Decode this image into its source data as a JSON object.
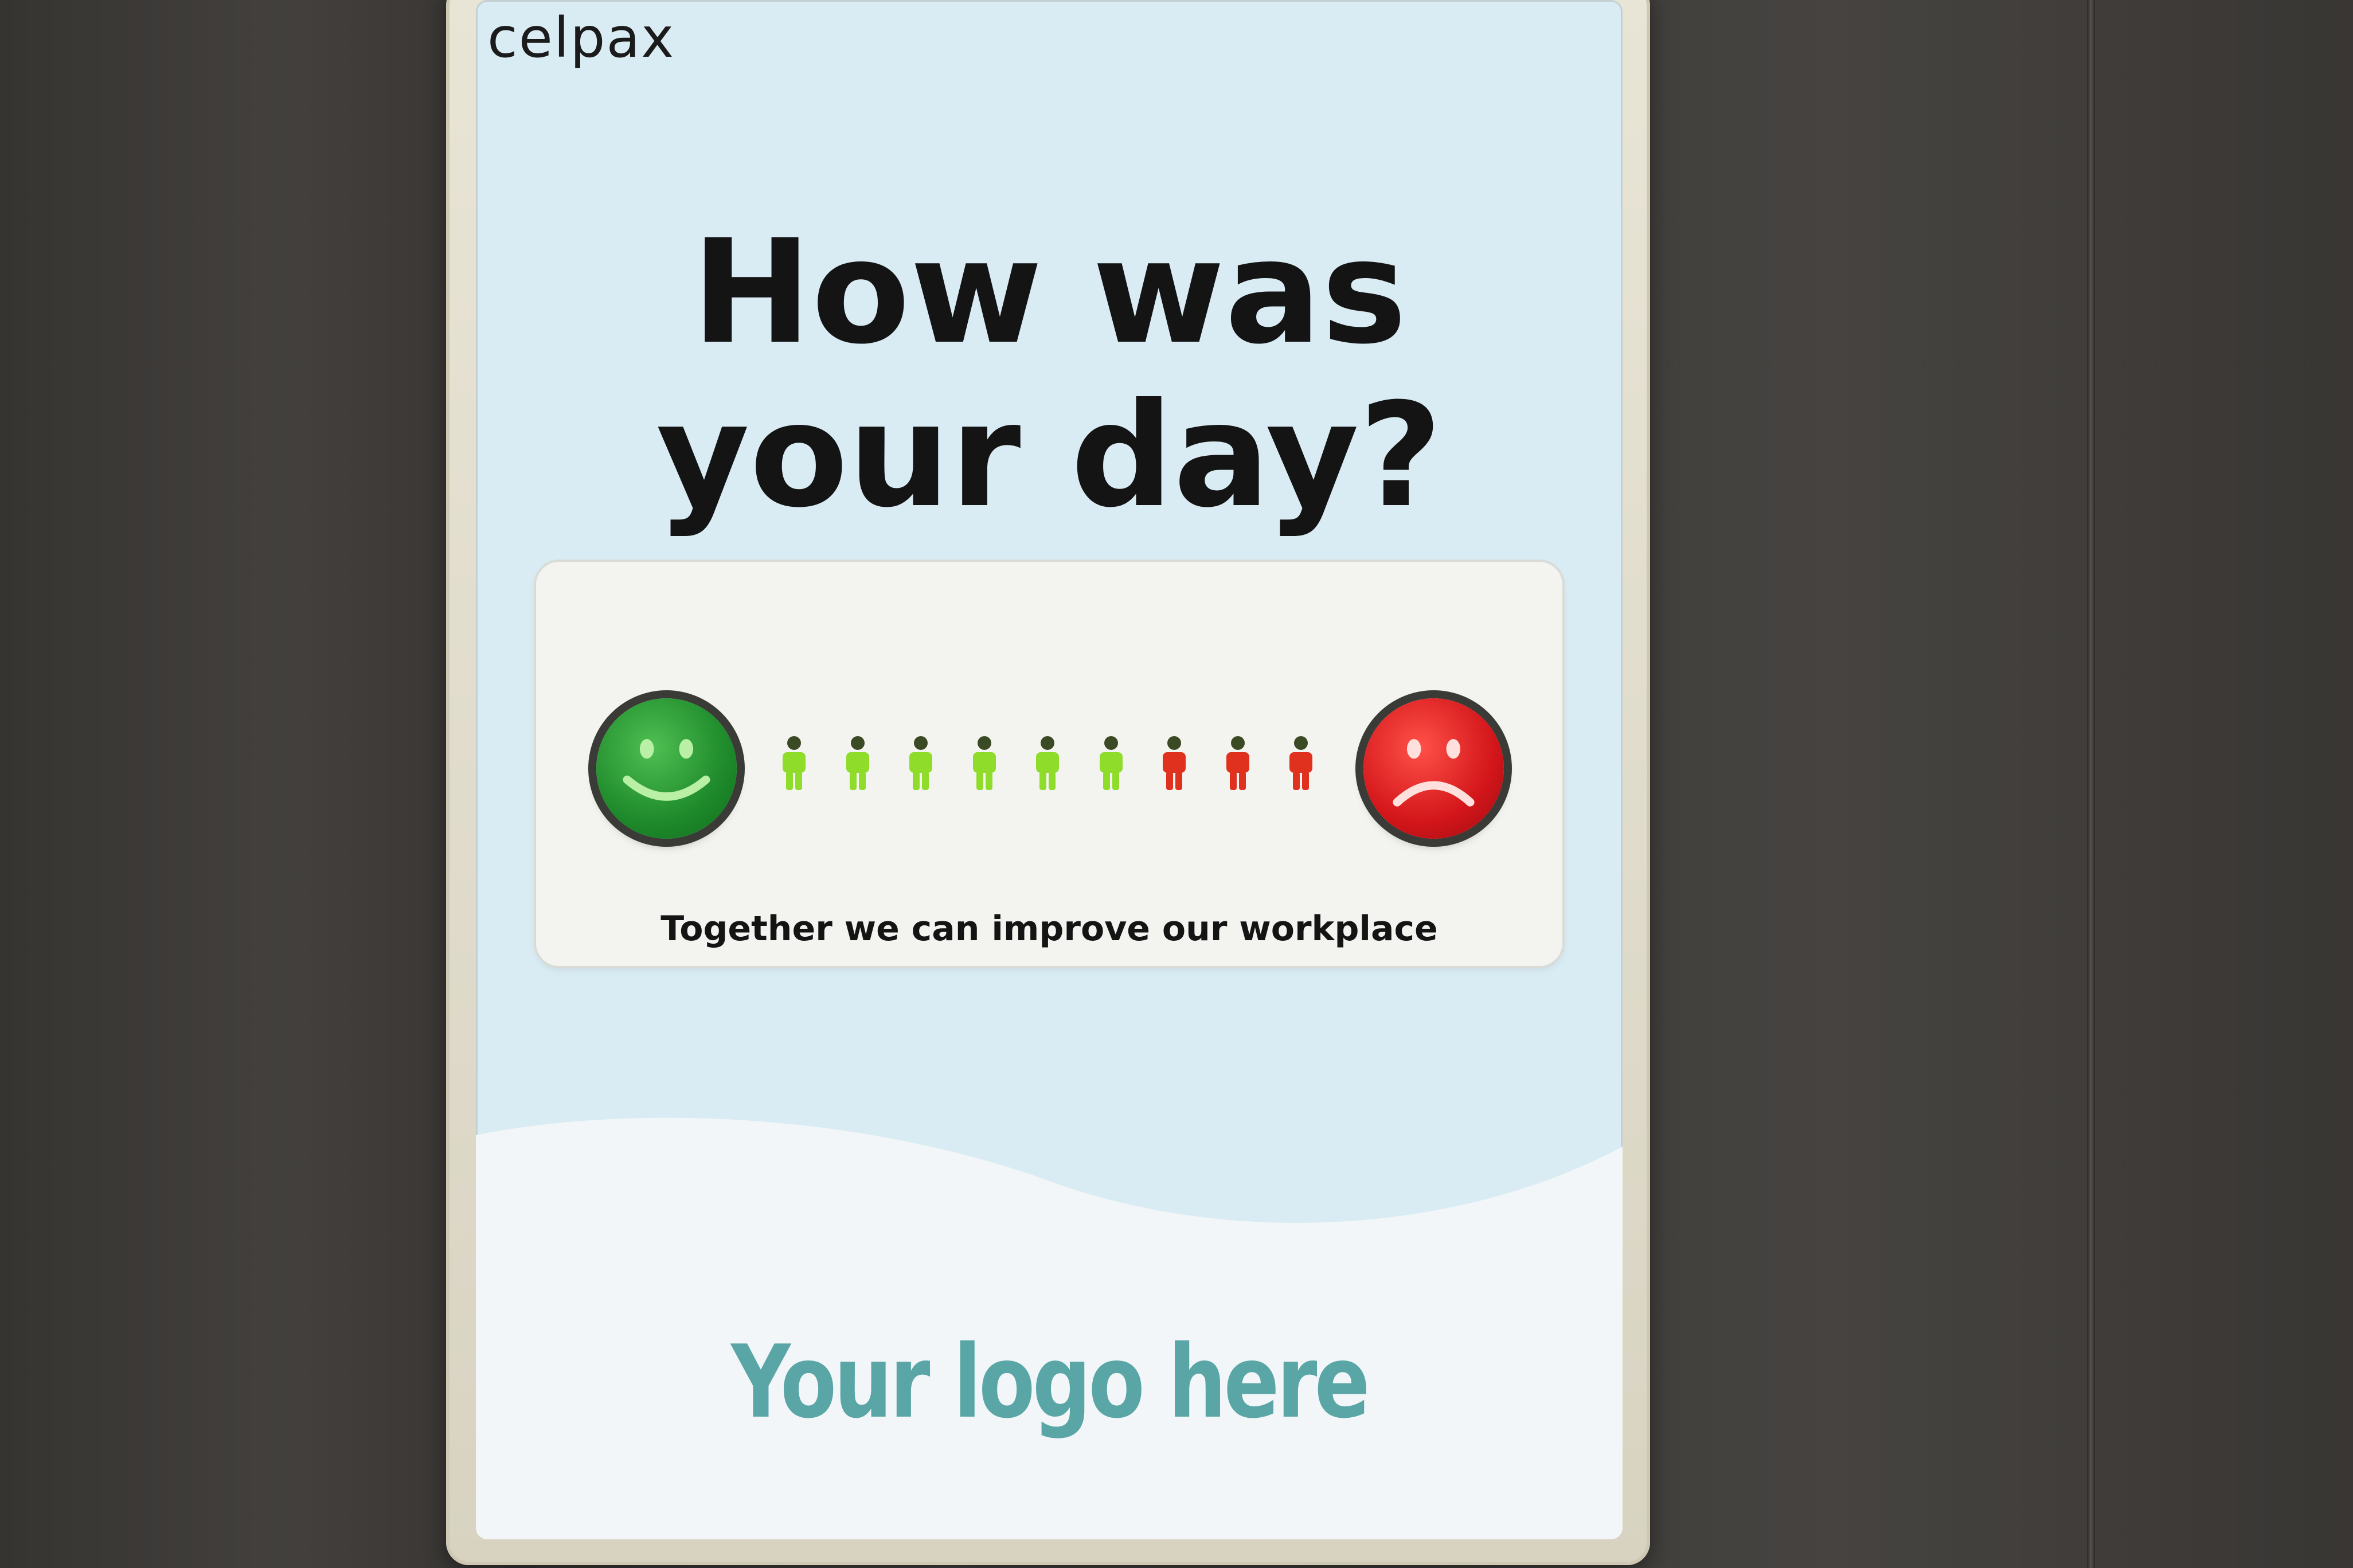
{
  "sign": {
    "brand": "celpax",
    "headline_line1": "How was",
    "headline_line2": "your day?",
    "caption": "Together we can improve our workplace",
    "logo_placeholder": "Your logo here"
  },
  "buttons": [
    {
      "name": "happy-face-button",
      "icon": "smiley-face-icon",
      "color": "#1e8a2b"
    },
    {
      "name": "sad-face-button",
      "icon": "frowning-face-icon",
      "color": "#d3161a"
    }
  ],
  "indicator": {
    "green_count": 6,
    "red_count": 3,
    "green_color": "#8fdc2a",
    "red_color": "#e0301e"
  },
  "colors": {
    "card_background": "#d9ebf3",
    "logo_text": "#5aa6a6"
  }
}
